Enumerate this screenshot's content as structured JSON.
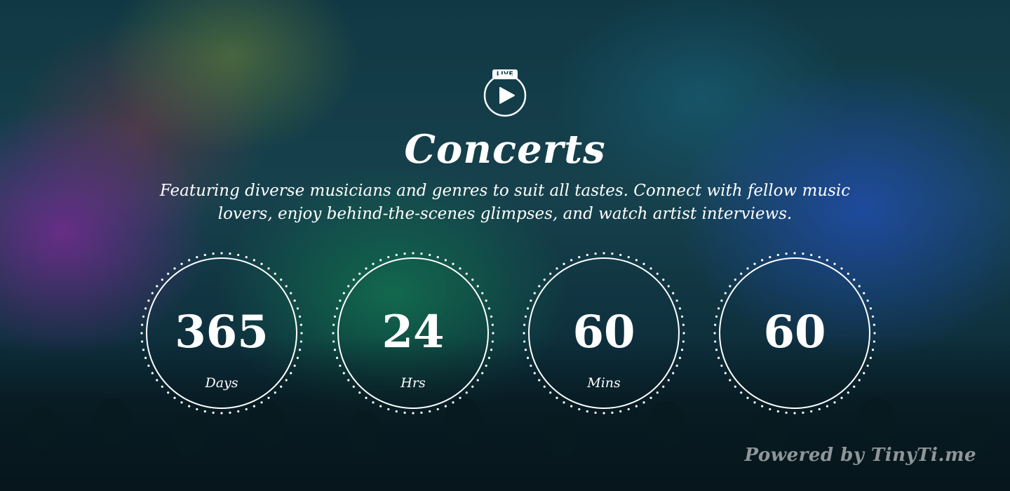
{
  "live_badge": "LIVE",
  "title": "Concerts",
  "description": "Featuring diverse musicians and genres to suit all tastes. Connect with fellow music lovers, enjoy behind-the-scenes glimpses, and watch artist interviews.",
  "countdown": [
    {
      "value": "365",
      "label": "Days"
    },
    {
      "value": "24",
      "label": "Hrs"
    },
    {
      "value": "60",
      "label": "Mins"
    },
    {
      "value": "60",
      "label": ""
    }
  ],
  "powered_by": "Powered by TinyTi.me",
  "icons": {
    "live": "live-play-icon"
  },
  "colors": {
    "text": "#ffffff",
    "badge_text": "#0d2c36"
  }
}
